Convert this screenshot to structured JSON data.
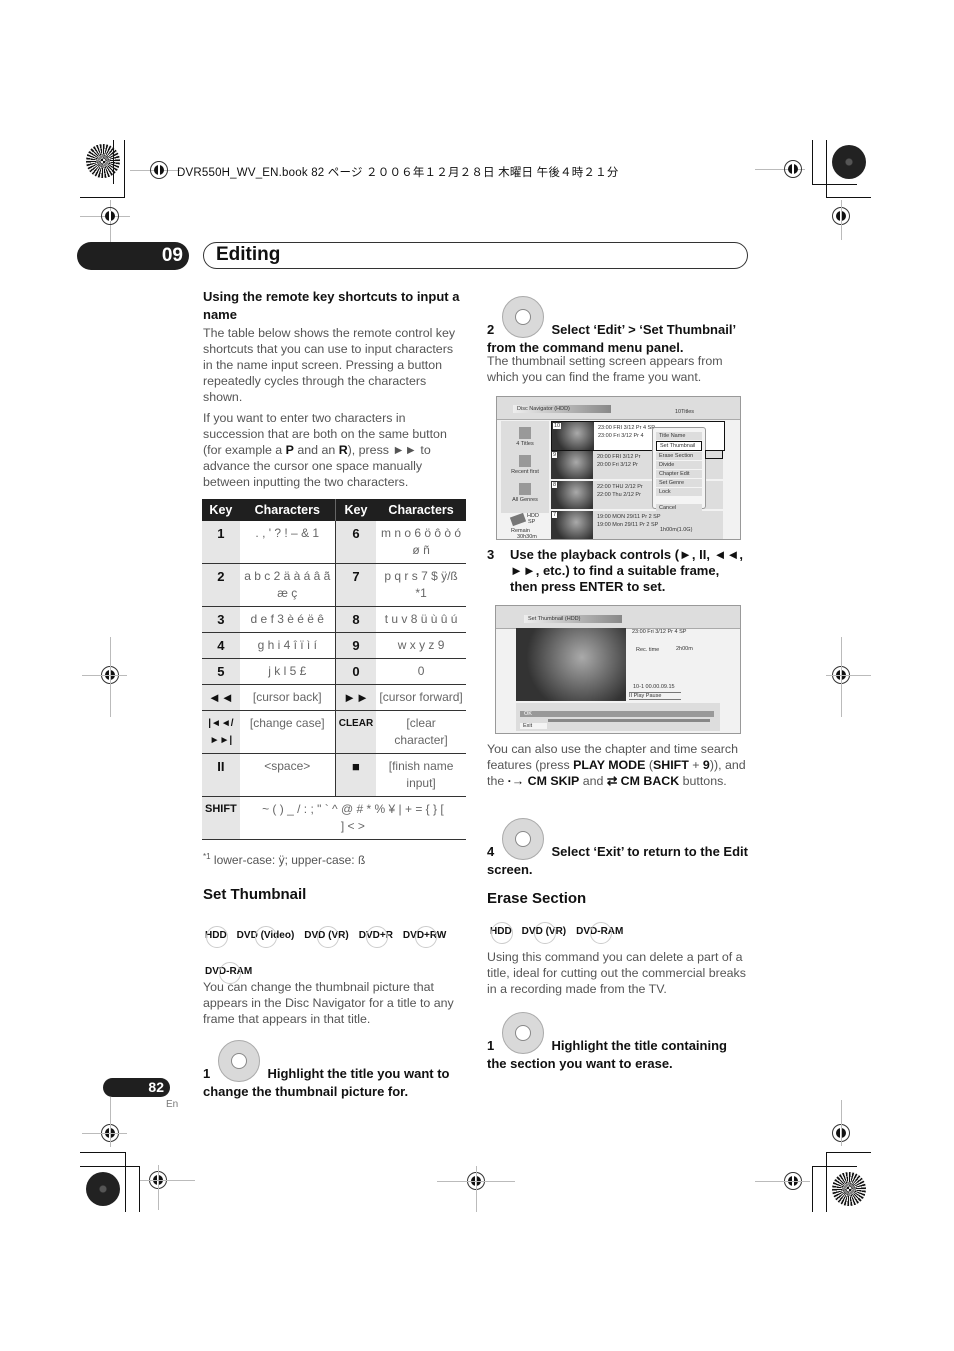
{
  "header": {
    "print_info": "DVR550H_WV_EN.book  82 ページ  ２００６年１２月２８日  木曜日  午後４時２１分",
    "chapter_number": "09",
    "chapter_title": "Editing"
  },
  "left": {
    "shortcuts_heading": "Using the remote key shortcuts to input a name",
    "para1": "The table below shows the remote control key shortcuts that you can use to input characters in the name input screen. Pressing a button repeatedly cycles through the characters shown.",
    "para2_a": "If you want to enter two characters in succession that are both on the same button (for example a ",
    "para2_p": "P",
    "para2_b": " and an ",
    "para2_r": "R",
    "para2_c": "), press ►► to advance the cursor one space manually between inputting the two characters.",
    "table": {
      "headers": [
        "Key",
        "Characters",
        "Key",
        "Characters"
      ],
      "rows": [
        [
          "1",
          ". , ' ? ! – & 1",
          "6",
          "m n o 6 ö ô ò ó ø ñ"
        ],
        [
          "2",
          "a b c 2 ä à á â ã æ ç",
          "7",
          "p q r s 7 $ ÿ/ß *1"
        ],
        [
          "3",
          "d e f 3 è é ë ê",
          "8",
          "t u v 8 ü ù û ú"
        ],
        [
          "4",
          "g h i 4 î ï ì í",
          "9",
          "w x y z 9"
        ],
        [
          "5",
          "j k l 5 £",
          "0",
          "0"
        ],
        [
          "◄◄",
          "[cursor back]",
          "►►",
          "[cursor forward]"
        ],
        [
          "|◄◄/ ►►|",
          "[change case]",
          "CLEAR",
          "[clear character]"
        ],
        [
          "II",
          "<space>",
          "■",
          "[finish name input]"
        ]
      ],
      "shift_key": "SHIFT",
      "shift_chars": "~ ( ) _ / : ; \" ` ^ @ # * % ¥ | + = { } [ ] < >"
    },
    "footnote_mark": "*1",
    "footnote": "lower-case: ÿ; upper-case: ß",
    "set_thumbnail_heading": "Set Thumbnail",
    "set_thumbnail_badges": [
      "HDD",
      "DVD (Video)",
      "DVD (VR)",
      "DVD+R",
      "DVD+RW",
      "DVD-RAM"
    ],
    "set_thumbnail_para": "You can change the thumbnail picture that appears in the Disc Navigator for a title to any frame that appears in that title.",
    "step1_num": "1",
    "step1_text": "Highlight the title you want to change the thumbnail picture for."
  },
  "right": {
    "step2_num": "2",
    "step2_text": "Select ‘Edit’ > ‘Set Thumbnail’ from the command menu panel.",
    "step2_para": "The thumbnail setting screen appears from which you can find the frame you want.",
    "screen1": {
      "title": "Disc Navigator (HDD)",
      "count": "10Titles",
      "side": [
        "4 Titles",
        "Recent first",
        "All Genres"
      ],
      "hdd": "HDD",
      "mode": "SP",
      "remain_label": "Remain",
      "remain": "30h30m",
      "titles": [
        {
          "num": "10",
          "line1": "23:00 FRI  3/12  Pr 4  SP",
          "line2": "23:00  Fri  3/12  Pr 4"
        },
        {
          "num": "9",
          "line1": "20:00  FRI  3/12  Pr",
          "line2": "20:00  Fri  3/12  Pr"
        },
        {
          "num": "8",
          "line1": "22:00  THU  2/12  Pr",
          "line2": "22:00  Thu  2/12  Pr"
        },
        {
          "num": "7",
          "line1": "19:00  MON  29/11  Pr 2  SP",
          "line2": "19:00  Mon  29/11  Pr 2  SP"
        }
      ],
      "duration": "1h00m(1.0G)",
      "menu": [
        "Title Name",
        "Set Thumbnail",
        "Erase Section",
        "Divide",
        "Chapter Edit",
        "Set Genre",
        "Lock",
        "Cancel"
      ]
    },
    "step3_num": "3",
    "step3_text": "Use the playback controls (►, II, ◄◄, ►►, etc.) to find a suitable frame, then press ENTER to set.",
    "screen2": {
      "title": "Set Thumbnail  (HDD)",
      "info": "23:00  Fri  3/12  Pr 4   SP",
      "rec_label": "Rec. time",
      "rec_value": "2h00m",
      "position": "10-1    00.00.09.15",
      "status": "II Play Pause",
      "ok": "OK",
      "exit": "Exit"
    },
    "also_para_a": "You can also use the chapter and time search features (press ",
    "also_playmode": "PLAY MODE",
    "also_shift": "SHIFT",
    "also_9": "9",
    "also_para_b": ")), and the ",
    "also_cmskip": "CM SKIP",
    "also_and": " and ",
    "also_cmback": "CM BACK",
    "also_buttons": " buttons.",
    "step4_num": "4",
    "step4_text": "Select ‘Exit’ to return to the Edit screen.",
    "erase_heading": "Erase Section",
    "erase_badges": [
      "HDD",
      "DVD (VR)",
      "DVD-RAM"
    ],
    "erase_para": "Using this command you can delete a part of a title, ideal for cutting out the commercial breaks in a recording made from the TV.",
    "erase_step1_num": "1",
    "erase_step1_text": "Highlight the title containing the section you want to erase."
  },
  "footer": {
    "page_number": "82",
    "language": "En"
  }
}
